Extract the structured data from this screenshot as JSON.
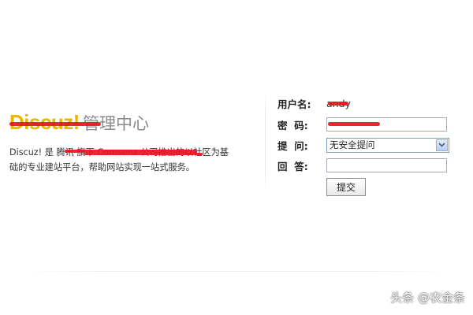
{
  "intro": {
    "logo": "Discuz!",
    "logo_suffix": "管理中心",
    "line1": "Discuz! 是 腾讯 旗下 Comsenz 公司推出的以社区为基",
    "line2": "础的专业建站平台，帮助网站实现一站式服务。"
  },
  "login": {
    "username_label": "用户名:",
    "username_value": "andy",
    "password_label": "密  码:",
    "question_label": "提  问:",
    "question_selected": "无安全提问",
    "answer_label": "回  答:",
    "submit_label": "提交"
  },
  "watermark": "头条 @农金条",
  "colors": {
    "logo": "#f0b400",
    "redaction": "#e8131c",
    "select_border": "#7f9db9"
  }
}
